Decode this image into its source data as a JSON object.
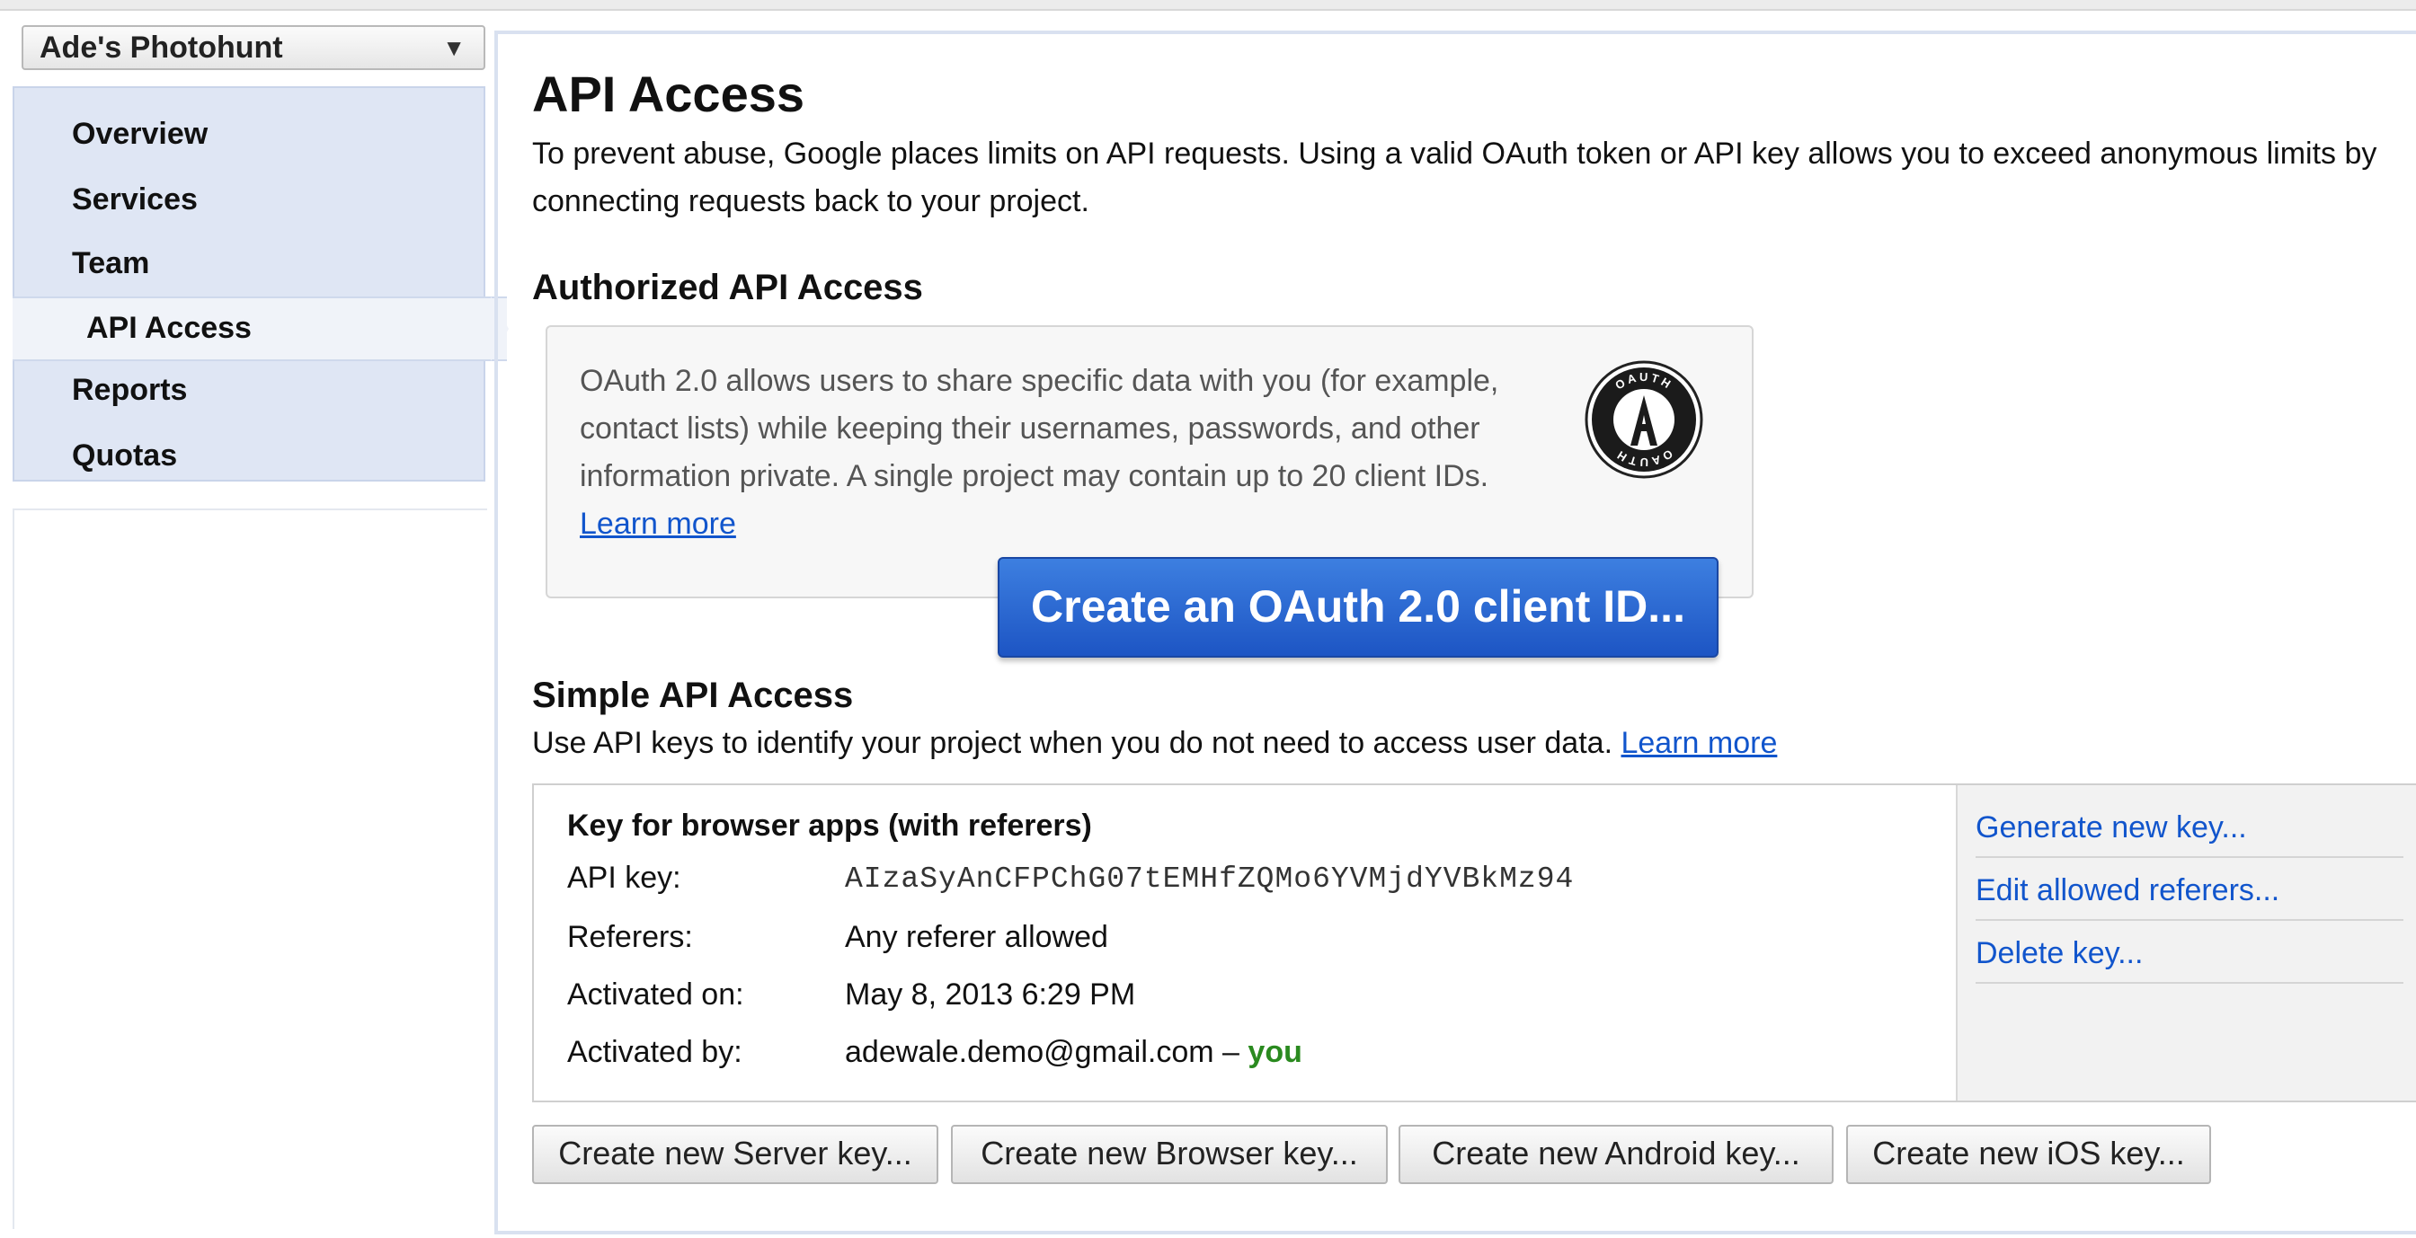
{
  "project_selector": {
    "value": "Ade's Photohunt",
    "caret": "▼"
  },
  "nav": {
    "items": [
      {
        "label": "Overview"
      },
      {
        "label": "Services"
      },
      {
        "label": "Team"
      },
      {
        "label": "API Access",
        "active": true
      },
      {
        "label": "Reports"
      },
      {
        "label": "Quotas"
      }
    ]
  },
  "page": {
    "title": "API Access",
    "intro": "To prevent abuse, Google places limits on API requests. Using a valid OAuth token or API key allows you to exceed anonymous limits by connecting requests back to your project."
  },
  "authorized": {
    "heading": "Authorized API Access",
    "description": "OAuth 2.0 allows users to share specific data with you (for example, contact lists) while keeping their usernames, passwords, and other information private. A single project may contain up to 20 client IDs.",
    "learn_more": "Learn more",
    "logo_text_top": "OAUTH",
    "logo_text_bottom": "OAUTH",
    "create_button": "Create an OAuth 2.0 client ID..."
  },
  "simple": {
    "heading": "Simple API Access",
    "description": "Use API keys to identify your project when you do not need to access user data.",
    "learn_more": "Learn more"
  },
  "key": {
    "title": "Key for browser apps (with referers)",
    "api_key_label": "API key:",
    "api_key_value": "AIzaSyAnCFPChG07tEMHfZQMo6YVMjdYVBkMz94",
    "referers_label": "Referers:",
    "referers_value": "Any referer allowed",
    "activated_on_label": "Activated on:",
    "activated_on_value": "May 8, 2013 6:29 PM",
    "activated_by_label": "Activated by:",
    "activated_by_value": "adewale.demo@gmail.com –",
    "activated_by_you": "you",
    "actions": {
      "generate": "Generate new key...",
      "edit": "Edit allowed referers...",
      "delete": "Delete key..."
    }
  },
  "create_buttons": {
    "server": "Create new Server key...",
    "browser": "Create new Browser key...",
    "android": "Create new Android key...",
    "ios": "Create new iOS key..."
  },
  "colors": {
    "link": "#1155cc",
    "primary_button": "#1d55c4",
    "nav_background": "#dfe6f4",
    "you": "#2a8a1f"
  }
}
